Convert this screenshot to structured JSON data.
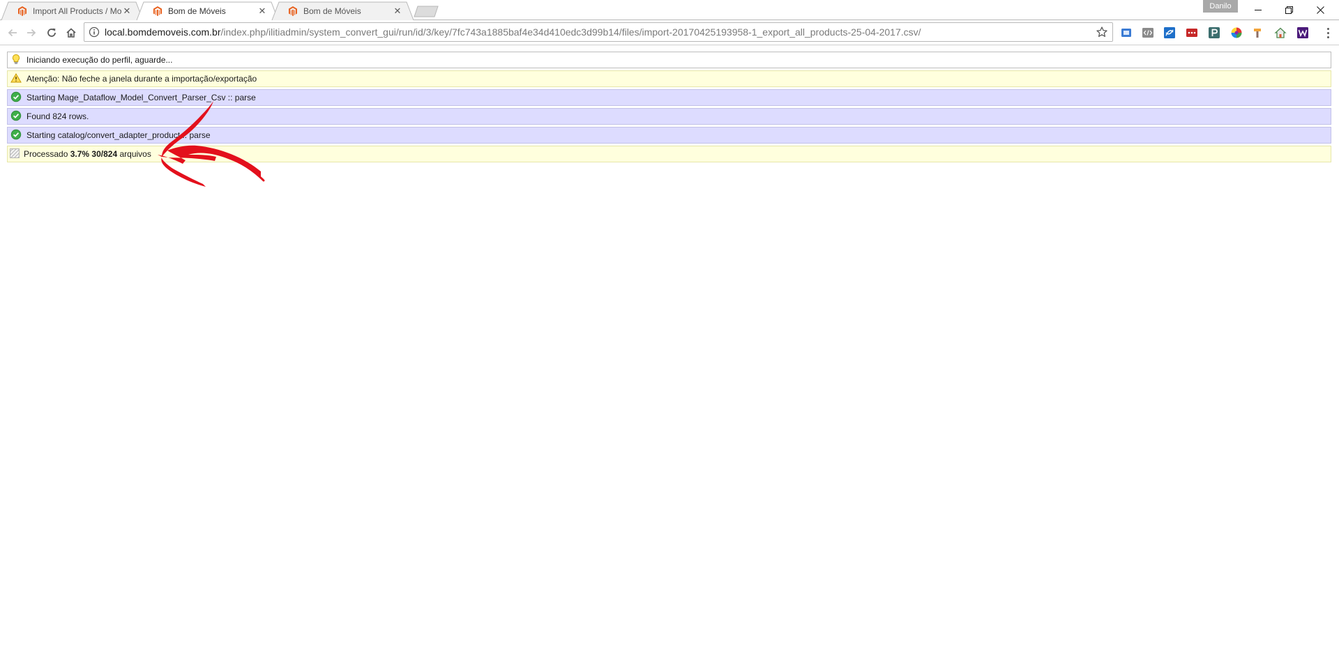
{
  "browser": {
    "tabs": [
      {
        "title": "Import All Products / Mo",
        "active": false
      },
      {
        "title": "Bom de Móveis",
        "active": true
      },
      {
        "title": "Bom de Móveis",
        "active": false
      }
    ],
    "tab_close_glyph": "✕",
    "user_name": "Danilo",
    "omnibox": {
      "host": "local.bomdemoveis.com.br",
      "path": "/index.php/ilitiadmin/system_convert_gui/run/id/3/key/7fc743a1885baf4e34d410edc3d99b14/files/import-20170425193958-1_export_all_products-25-04-2017.csv/"
    },
    "extensions": [
      {
        "icon": "bookmark-ext-icon",
        "color": "#3b7bd4",
        "glyph": ""
      },
      {
        "icon": "code-ext-icon",
        "color": "#8a8a8a",
        "glyph": "</>"
      },
      {
        "icon": "screenshot-ext-icon",
        "color": "#1e6fc9",
        "glyph": ""
      },
      {
        "icon": "counter-ext-icon",
        "color": "#c62828",
        "glyph": "•••"
      },
      {
        "icon": "pinterest-ext-icon",
        "color": "#3c6e6e",
        "glyph": "P"
      },
      {
        "icon": "color-picker-ext-icon",
        "color": "#ffffff",
        "glyph": ""
      },
      {
        "icon": "hammer-ext-icon",
        "color": "#ffffff",
        "glyph": ""
      },
      {
        "icon": "home-ext-icon",
        "color": "#ffffff",
        "glyph": ""
      },
      {
        "icon": "wappalyzer-ext-icon",
        "color": "#4b1a7a",
        "glyph": "W"
      }
    ],
    "colors": {
      "magento_orange": "#e8601d",
      "info_bg": "#ffffff",
      "warning_bg": "#ffffdd",
      "success_bg": "#dddcff",
      "arrow_red": "#e3101c"
    }
  },
  "messages": [
    {
      "type": "info",
      "icon": "lightbulb-icon",
      "text": "Iniciando execução do perfil, aguarde..."
    },
    {
      "type": "warn",
      "icon": "warning-icon",
      "text": "Atenção: Não feche a janela durante a importação/exportação"
    },
    {
      "type": "ok",
      "icon": "success-check-icon",
      "text": "Starting Mage_Dataflow_Model_Convert_Parser_Csv :: parse"
    },
    {
      "type": "ok",
      "icon": "success-check-icon",
      "text": "Found 824 rows."
    },
    {
      "type": "ok",
      "icon": "success-check-icon",
      "text": "Starting catalog/convert_adapter_product :: parse"
    }
  ],
  "progress": {
    "icon": "progress-stripes-icon",
    "prefix": "Processado",
    "percent": "3.7%",
    "current": "30",
    "separator": "/",
    "total": "824",
    "suffix": "arquivos"
  }
}
